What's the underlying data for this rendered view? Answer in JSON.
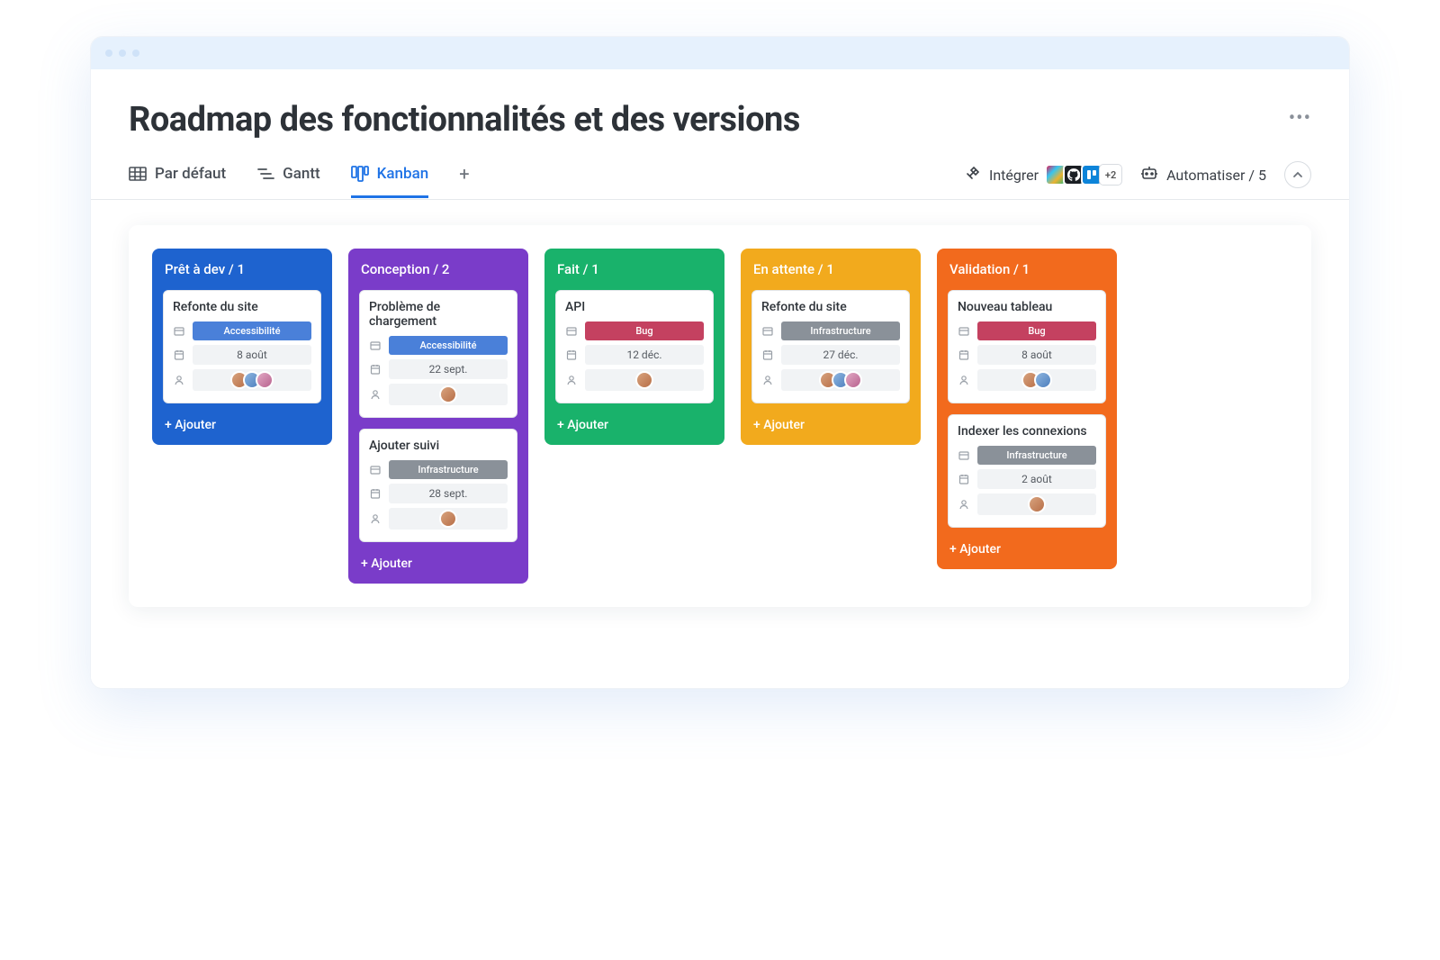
{
  "page_title": "Roadmap des fonctionnalités et des versions",
  "views": {
    "default_label": "Par défaut",
    "gantt_label": "Gantt",
    "kanban_label": "Kanban"
  },
  "toolbar": {
    "integrate_label": "Intégrer",
    "integrate_more": "+2",
    "automate_label": "Automatiser / 5"
  },
  "add_label": "+ Ajouter",
  "columns": [
    {
      "header": "Prêt à dev / 1",
      "color": "blue",
      "cards": [
        {
          "title": "Refonte du site",
          "tag": "Accessibilité",
          "tag_kind": "access",
          "date": "8 août",
          "avatars": 3
        }
      ]
    },
    {
      "header": "Conception / 2",
      "color": "purple",
      "cards": [
        {
          "title": "Problème de chargement",
          "tag": "Accessibilité",
          "tag_kind": "access",
          "date": "22 sept.",
          "avatars": 1
        },
        {
          "title": "Ajouter suivi",
          "tag": "Infrastructure",
          "tag_kind": "infra",
          "date": "28 sept.",
          "avatars": 1
        }
      ]
    },
    {
      "header": "Fait / 1",
      "color": "green",
      "cards": [
        {
          "title": "API",
          "tag": "Bug",
          "tag_kind": "bug",
          "date": "12 déc.",
          "avatars": 1
        }
      ]
    },
    {
      "header": "En attente / 1",
      "color": "orange-l",
      "cards": [
        {
          "title": "Refonte du site",
          "tag": "Infrastructure",
          "tag_kind": "infra",
          "date": "27 déc.",
          "avatars": 3
        }
      ]
    },
    {
      "header": "Validation / 1",
      "color": "orange",
      "cards": [
        {
          "title": "Nouveau tableau",
          "tag": "Bug",
          "tag_kind": "bug",
          "date": "8 août",
          "avatars": 2
        },
        {
          "title": "Indexer les connexions",
          "tag": "Infrastructure",
          "tag_kind": "infra",
          "date": "2 août",
          "avatars": 1
        }
      ]
    }
  ]
}
